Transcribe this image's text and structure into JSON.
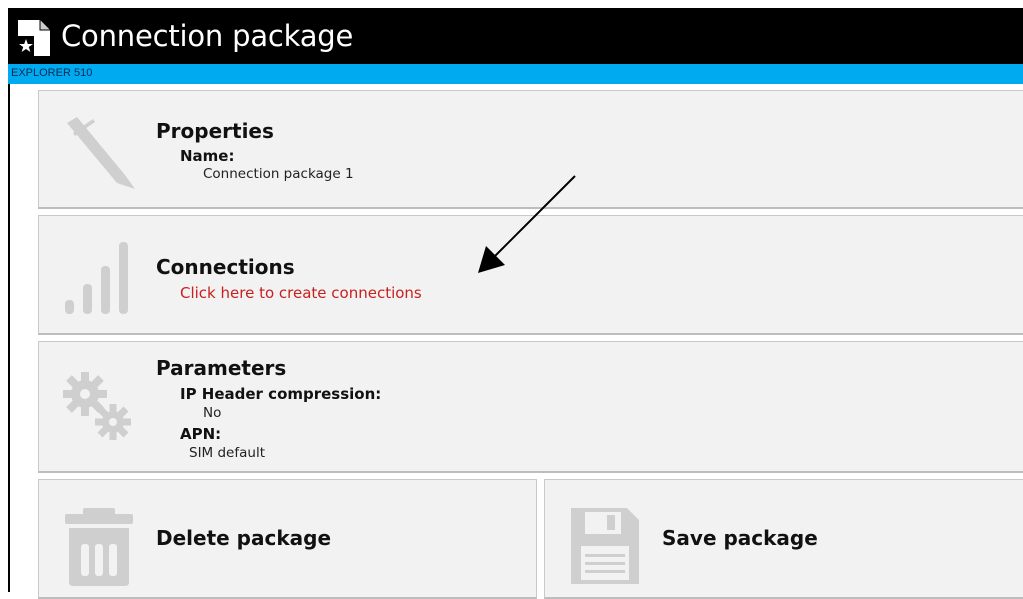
{
  "window": {
    "title": "Connection package",
    "device_label": "EXPLORER 510"
  },
  "properties": {
    "heading": "Properties",
    "name_label": "Name:",
    "name_value": "Connection package 1",
    "icon": "pen-icon"
  },
  "connections": {
    "heading": "Connections",
    "link": "Click here to create connections",
    "icon": "signal-bars-icon"
  },
  "parameters": {
    "heading": "Parameters",
    "ip_header_label": "IP Header compression:",
    "ip_header_value": "No",
    "apn_label": "APN:",
    "apn_value": "SIM default",
    "icon": "gears-icon"
  },
  "actions": {
    "delete_label": "Delete package",
    "delete_icon": "trash-icon",
    "save_label": "Save package",
    "save_icon": "floppy-disk-icon"
  },
  "colors": {
    "title_bar": "#000000",
    "sub_bar": "#00aaf0",
    "link": "#c8201e",
    "panel": "#f2f2f2"
  }
}
